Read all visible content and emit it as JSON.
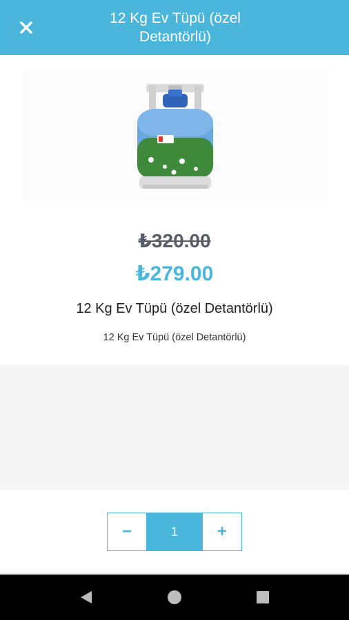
{
  "header": {
    "title": "12 Kg Ev Tüpü (özel Detantörlü)",
    "close_icon": "close-icon",
    "background_color": "#4bb6dc"
  },
  "product": {
    "old_price": "₺320.00",
    "new_price": "₺279.00",
    "name": "12 Kg Ev Tüpü (özel Detantörlü)",
    "description": "12 Kg Ev Tüpü (özel Detantörlü)",
    "image_alt": "gas-cylinder-image"
  },
  "quantity": {
    "minus_label": "−",
    "value": "1",
    "plus_label": "+"
  },
  "nav": {
    "back_icon": "back-triangle-icon",
    "home_icon": "home-circle-icon",
    "recents_icon": "recents-square-icon"
  },
  "colors": {
    "accent": "#4bb6dc",
    "old_price": "#575d67",
    "text": "#222222"
  }
}
